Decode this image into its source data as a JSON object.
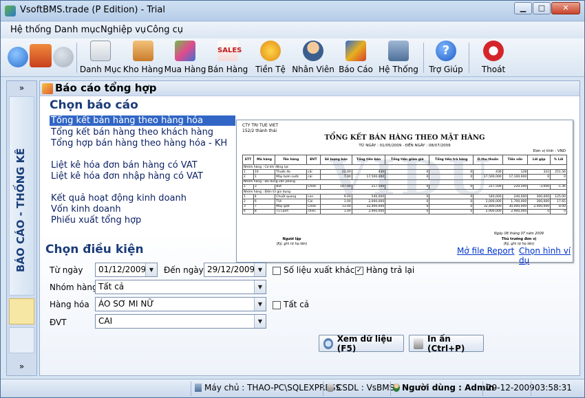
{
  "window": {
    "title": "VsoftBMS.trade (P Edition) - Trial"
  },
  "menu": [
    "Hệ thống",
    "Danh mục",
    "Nghiệp vụ",
    "Công cụ"
  ],
  "toolbar": {
    "items": [
      "Danh Mục",
      "Kho Hàng",
      "Mua Hàng",
      "Bán Hàng",
      "Tiền Tệ",
      "Nhân Viên",
      "Báo Cáo",
      "Hệ Thống",
      "Trợ Giúp",
      "Thoát"
    ]
  },
  "sidebar": {
    "vertical_title": "BÁO CÁO - THỐNG KÊ",
    "expand": "»"
  },
  "main": {
    "header": "Báo cáo tổng hợp",
    "choose_report": "Chọn báo cáo",
    "reports": [
      "Tổng kết bán hàng theo hàng hóa",
      "Tổng kết bán  hàng theo khách hàng",
      "Tổng hợp bán hàng theo hàng hóa - KH",
      "Liệt kê hóa đơn bán hàng có VAT",
      "Liệt kê hóa đơn nhập hàng có VAT",
      "Kết quả hoạt động kinh doanh",
      "Vốn kinh doanh",
      "Phiếu xuất tổng hợp"
    ],
    "conditions_title": "Chọn điều kiện",
    "open_report_link": "Mở file Report",
    "choose_sample_link": "Chọn hình ví dụ",
    "from_date_label": "Từ ngày",
    "from_date": "01/12/2009",
    "to_date_label": "Đến ngày",
    "to_date": "29/12/2009",
    "other_export_label": "Số liệu xuất khác",
    "return_goods_label": "Hàng trả lại",
    "group_label": "Nhóm hàng",
    "group_value": "Tất cả",
    "goods_label": "Hàng hóa",
    "goods_value": "ÁO SƠ MI NỮ",
    "all_label": "Tất cả",
    "unit_label": "ĐVT",
    "unit_value": "CAI",
    "view_button": "Xem dữ liệu (F5)",
    "print_button": "In ấn (Ctrl+P)"
  },
  "preview": {
    "company": "CTY TRI TUE VIET",
    "address": "152/2 thành thái",
    "title": "TỔNG KẾT BÁN HÀNG THEO MẶT HÀNG",
    "range": "TỪ NGÀY : 01/05/2009 - ĐẾN NGÀY : 08/07/2009",
    "unit": "Đơn vị tính : VND",
    "watermark": "VIDU",
    "headers": [
      "STT",
      "Mã hàng",
      "Tên hàng",
      "ĐVT",
      "Số lượng bán",
      "Tổng tiền bán",
      "Tổng tiền giảm giá",
      "Tổng tiền trả hàng",
      "D.thu thuần",
      "Tiền vốn",
      "Lời gộp",
      "% Lời"
    ],
    "rows": [
      [
        "Nhóm hàng : Cơ khí động lực"
      ],
      [
        "1",
        "10",
        "Thước đo",
        "cái",
        "22.00",
        "430",
        "0",
        "0",
        "430",
        "128",
        "322",
        "251.56"
      ],
      [
        "2",
        "1",
        "Máy bơm nước",
        "cái",
        "7.00",
        "17,500,000",
        "0",
        "0",
        "17,500,000",
        "17,100,000",
        "0",
        "0"
      ],
      [
        "Nhóm hàng : Đồ dùng văn phòng"
      ],
      [
        "1",
        "3",
        "Bút",
        "Chiếc",
        "147.00",
        "217,500",
        "0",
        "0",
        "217,500",
        "220,500",
        "-3,000",
        "-1.36"
      ],
      [
        "Nhóm hàng : Điện tử gia dụng"
      ],
      [
        "1",
        "4",
        "Chuột quang",
        "con",
        "9.00",
        "540,000",
        "0",
        "0",
        "540,000",
        "240,000",
        "300,000",
        "125.00"
      ],
      [
        "2",
        "6",
        "TiVi",
        "Cái",
        "1.00",
        "2,000,000",
        "0",
        "0",
        "2,000,000",
        "1,700,000",
        "300,000",
        "17.65"
      ],
      [
        "3",
        "7",
        "Máy giặt",
        "Chiếc",
        "13.00",
        "32,400,000",
        "0",
        "0",
        "32,400,000",
        "30,000,000",
        "2,400,000",
        "8.00"
      ],
      [
        "4",
        "8",
        "Tủ Lạnh",
        "chiếc",
        "1.00",
        "2,900,000",
        "0",
        "0",
        "2,900,000",
        "2,900,000",
        "0",
        "0"
      ]
    ],
    "date_line": "Ngày 08 tháng 07 năm 2009",
    "preparer": "Người lập",
    "preparer_sign": "(Ký, ghi rõ họ tên)",
    "director": "Thủ trưởng đơn vị",
    "director_sign": "(Ký, ghi rõ họ tên)"
  },
  "status": {
    "server": "Máy chủ : THAO-PC\\SQLEXPRESS",
    "database": "CSDL : VsBMS",
    "user": "Người dùng : Admin",
    "date": "29-12-2009",
    "time": "03:58:31"
  }
}
